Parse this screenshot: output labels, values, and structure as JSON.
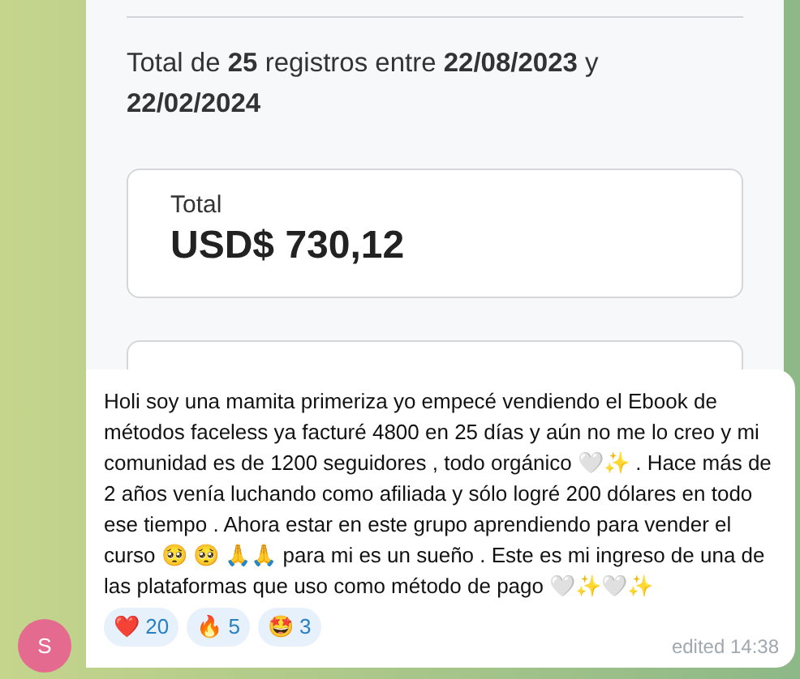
{
  "shared_image": {
    "summary": "Total de **25** registros entre **22/08/2023** y **22/02/2024**",
    "total_card": {
      "label": "Total",
      "amount": "USD$ 730,12"
    }
  },
  "message": {
    "sender_initial": "S",
    "text": "Holi soy una mamita primeriza  yo empecé vendiendo el Ebook de métodos faceless ya facturé 4800 en 25 días y aún no me lo creo y mi comunidad es de 1200 seguidores , todo orgánico 🤍✨ . Hace más de 2 años venía luchando como afiliada y sólo logré 200 dólares en todo ese tiempo . Ahora estar en este grupo aprendiendo para vender el curso 🥺 🥺 🙏🙏 para mi es un sueño . Este es mi ingreso de una de las plataformas que uso como método de pago 🤍✨🤍✨",
    "reactions": [
      {
        "emoji": "❤️",
        "count": "20"
      },
      {
        "emoji": "🔥",
        "count": "5"
      },
      {
        "emoji": "🤩",
        "count": "3"
      }
    ],
    "time": "edited 14:38"
  }
}
